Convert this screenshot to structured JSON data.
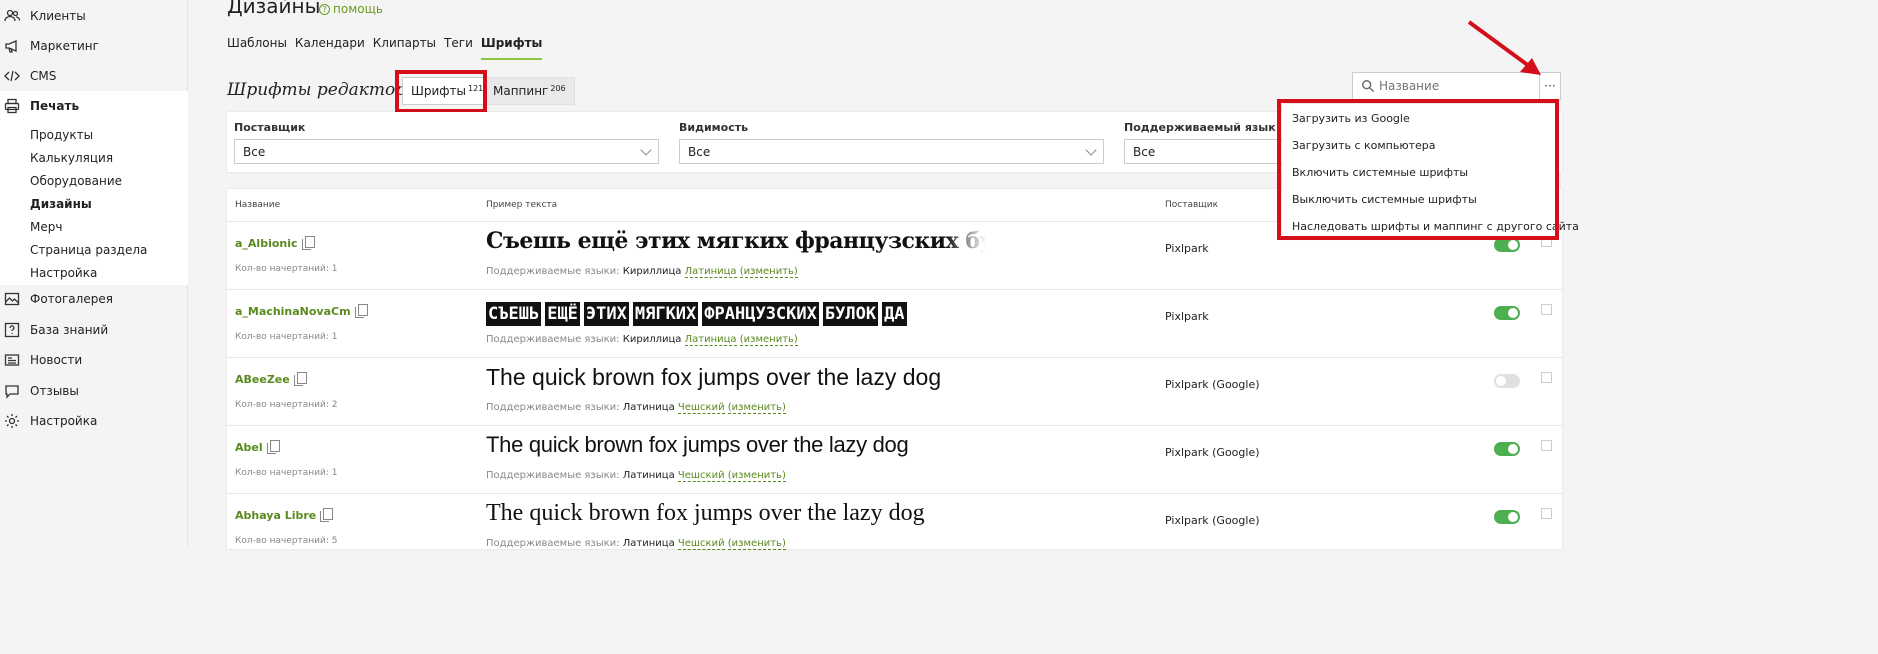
{
  "sidebar": {
    "items": [
      {
        "label": "Клиенты",
        "icon": "users-icon"
      },
      {
        "label": "Маркетинг",
        "icon": "megaphone-icon"
      },
      {
        "label": "CMS",
        "icon": "code-icon"
      },
      {
        "label": "Печать",
        "icon": "printer-icon"
      },
      {
        "label": "Фотогалерея",
        "icon": "gallery-icon"
      },
      {
        "label": "База знаний",
        "icon": "question-icon"
      },
      {
        "label": "Новости",
        "icon": "news-icon"
      },
      {
        "label": "Отзывы",
        "icon": "reviews-icon"
      },
      {
        "label": "Настройка",
        "icon": "settings-icon"
      }
    ],
    "print_subitems": [
      "Продукты",
      "Калькуляция",
      "Оборудование",
      "Дизайны",
      "Мерч",
      "Страница раздела",
      "Настройка"
    ],
    "current_subitem": "Дизайны"
  },
  "header": {
    "title": "Дизайны",
    "help": "помощь",
    "tabs": [
      "Шаблоны",
      "Календари",
      "Клипарты",
      "Теги",
      "Шрифты"
    ],
    "active_tab": "Шрифты"
  },
  "section": {
    "title": "Шрифты редактора",
    "fonts_tab": {
      "label": "Шрифты",
      "count": "1216"
    },
    "mapping_tab": {
      "label": "Маппинг",
      "count": "206"
    },
    "search_placeholder": "Название",
    "more_label": "···"
  },
  "filters": {
    "provider": {
      "label": "Поставщик",
      "value": "Все"
    },
    "visibility": {
      "label": "Видимость",
      "value": "Все"
    },
    "language": {
      "label": "Поддерживаемый язык:",
      "value": "Все"
    }
  },
  "menu": {
    "items": [
      "Загрузить из Google",
      "Загрузить с компьютера",
      "Включить системные шрифты",
      "Выключить системные шрифты",
      "Наследовать шрифты и маппинг с другого сайта"
    ]
  },
  "table": {
    "headers": {
      "name": "Название",
      "sample": "Пример текста",
      "provider": "Поставщик"
    },
    "langs_prefix": "Поддерживаемые языки:",
    "change_label": "(изменить)",
    "styles_prefix": "Кол-во начертаний:",
    "rows": [
      {
        "name": "a_Albionic",
        "styles": "Кол-во начертаний: 1",
        "sample": "Съешь ещё этих мягких французских булок да выпей же чаю",
        "lang1": "Кириллица",
        "lang2": "Латиница",
        "provider": "Pixlpark",
        "enabled": true
      },
      {
        "name": "a_MachinaNovaCm",
        "styles": "Кол-во начертаний: 1",
        "sample": "СЪЕШЬ ЕЩЁ ЭТИХ МЯГКИХ ФРАНЦУЗСКИХ БУЛОК ДА",
        "lang1": "Кириллица",
        "lang2": "Латиница",
        "provider": "Pixlpark",
        "enabled": true
      },
      {
        "name": "ABeeZee",
        "styles": "Кол-во начертаний: 2",
        "sample": "The quick brown fox jumps over the lazy dog",
        "lang1": "Латиница",
        "lang2": "Чешский",
        "provider": "Pixlpark (Google)",
        "enabled": false
      },
      {
        "name": "Abel",
        "styles": "Кол-во начертаний: 1",
        "sample": "The quick brown fox jumps over the lazy dog",
        "lang1": "Латиница",
        "lang2": "Чешский",
        "provider": "Pixlpark (Google)",
        "enabled": true
      },
      {
        "name": "Abhaya Libre",
        "styles": "Кол-во начертаний: 5",
        "sample": "The quick brown fox jumps over the lazy dog",
        "lang1": "Латиница",
        "lang2": "Чешский",
        "provider": "Pixlpark (Google)",
        "enabled": true
      }
    ]
  },
  "colors": {
    "accent": "#8cc63f",
    "link": "#5a8a1e",
    "highlight": "#d40f1a",
    "toggle_on": "#4caf50"
  }
}
